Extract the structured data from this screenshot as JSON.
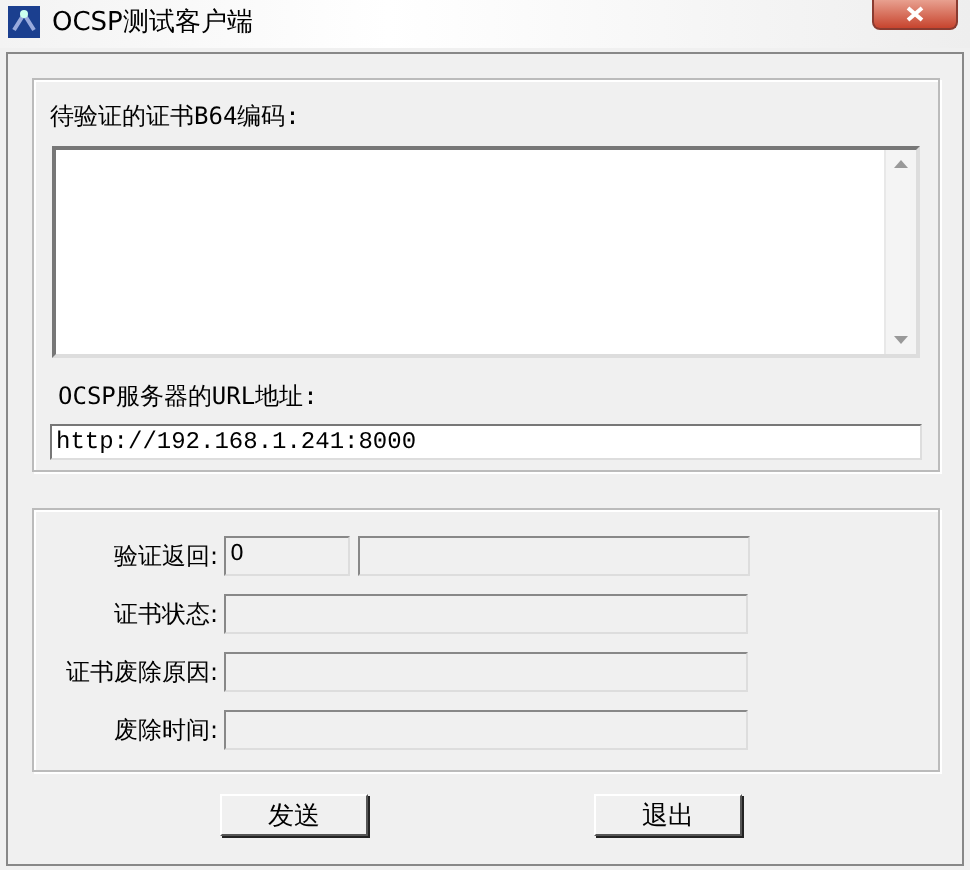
{
  "window": {
    "title": "OCSP测试客户端"
  },
  "request": {
    "cert_label": "待验证的证书B64编码:",
    "url_label": "OCSP服务器的URL地址:",
    "url_value": "http://192.168.1.241:8000"
  },
  "results": [
    {
      "label": "验证返回:",
      "kind": "split",
      "code": "0"
    },
    {
      "label": "证书状态:",
      "kind": "single"
    },
    {
      "label": "证书废除原因:",
      "kind": "single"
    },
    {
      "label": "废除时间:",
      "kind": "single"
    }
  ],
  "buttons": [
    "发送",
    "退出"
  ]
}
